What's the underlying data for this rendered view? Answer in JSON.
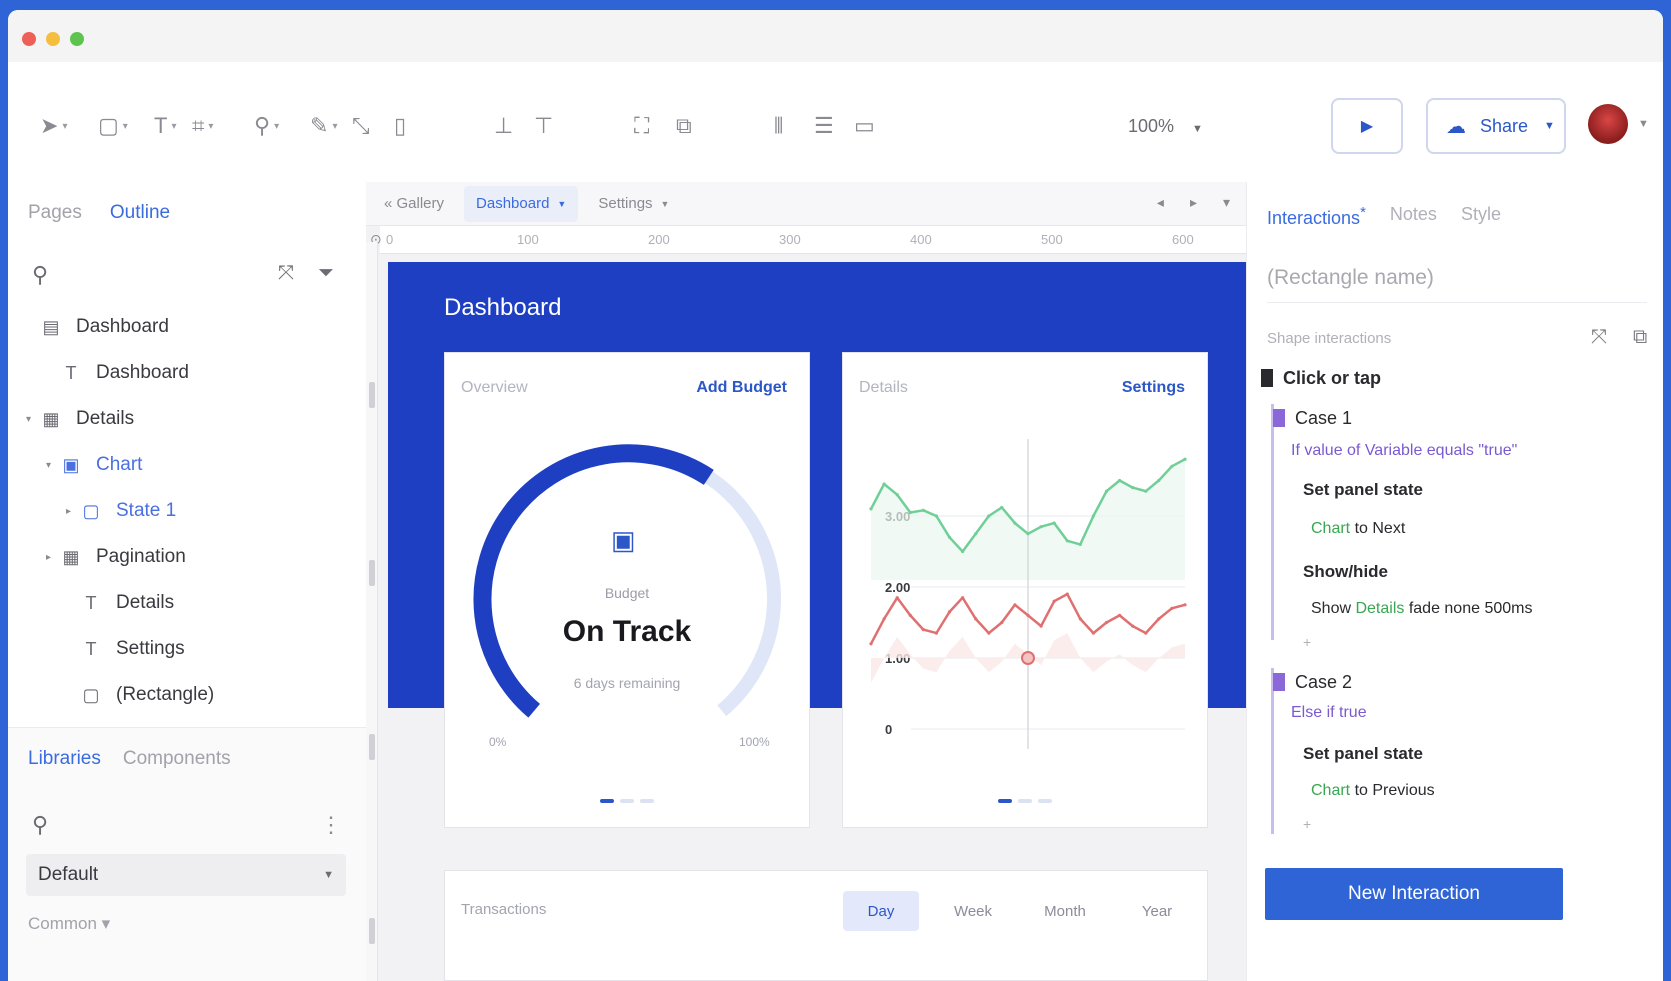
{
  "toolbar": {
    "tools": [
      {
        "icon": "pointer-icon",
        "glyph": "➤",
        "caret": "▾"
      },
      {
        "icon": "rectangle-tool-icon",
        "glyph": "▢",
        "caret": "▾"
      },
      {
        "icon": "text-tool-icon",
        "glyph": "T",
        "caret": "▾"
      },
      {
        "icon": "hotspot-tool-icon",
        "glyph": "⌗",
        "caret": "▾"
      },
      {
        "icon": "pin-tool-icon",
        "glyph": "⚲",
        "caret": "▾"
      },
      {
        "icon": "pen-tool-icon",
        "glyph": "✎",
        "caret": "▾"
      },
      {
        "icon": "connector-tool-icon",
        "glyph": "⤡",
        "caret": ""
      },
      {
        "icon": "note-tool-icon",
        "glyph": "▯",
        "caret": ""
      },
      {
        "icon": "align-top-icon",
        "glyph": "⊥",
        "caret": ""
      },
      {
        "icon": "align-middle-icon",
        "glyph": "⊤",
        "caret": ""
      },
      {
        "icon": "group-icon",
        "glyph": "⛶",
        "caret": ""
      },
      {
        "icon": "ungroup-icon",
        "glyph": "⧉",
        "caret": ""
      },
      {
        "icon": "distribute-horizontal-icon",
        "glyph": "⫴",
        "caret": ""
      },
      {
        "icon": "distribute-vertical-icon",
        "glyph": "☰",
        "caret": ""
      },
      {
        "icon": "lock-icon",
        "glyph": "▭",
        "caret": ""
      }
    ],
    "zoom": "100%",
    "share_label": "Share"
  },
  "left": {
    "tabs": [
      "Pages",
      "Outline"
    ],
    "active_tab": "Outline",
    "tree": [
      {
        "label": "Dashboard",
        "icon": "page-icon",
        "glyph": "▤",
        "arrow": "",
        "indent": 0,
        "blue": false
      },
      {
        "label": "Dashboard",
        "icon": "text-icon",
        "glyph": "T",
        "arrow": "",
        "indent": 1,
        "blue": false
      },
      {
        "label": "Details",
        "icon": "folder-icon",
        "glyph": "▦",
        "arrow": "▾",
        "indent": 0,
        "blue": false
      },
      {
        "label": "Chart",
        "icon": "dynamic-panel-icon",
        "glyph": "▣",
        "arrow": "▾",
        "indent": 1,
        "blue": true
      },
      {
        "label": "State 1",
        "icon": "state-icon",
        "glyph": "▢",
        "arrow": "▸",
        "indent": 2,
        "blue": true
      },
      {
        "label": "Pagination",
        "icon": "folder-icon",
        "glyph": "▦",
        "arrow": "▸",
        "indent": 1,
        "blue": false
      },
      {
        "label": "Details",
        "icon": "text-icon",
        "glyph": "T",
        "arrow": "",
        "indent": 2,
        "blue": false
      },
      {
        "label": "Settings",
        "icon": "text-icon",
        "glyph": "T",
        "arrow": "",
        "indent": 2,
        "blue": false
      },
      {
        "label": "(Rectangle)",
        "icon": "rectangle-icon",
        "glyph": "▢",
        "arrow": "",
        "indent": 2,
        "blue": false
      }
    ],
    "libraries": {
      "tabs": [
        "Libraries",
        "Components"
      ],
      "active_tab": "Libraries",
      "selected_library": "Default",
      "section": "Common ▾"
    }
  },
  "canvas": {
    "tabs": [
      {
        "label": "« Gallery",
        "active": false,
        "caret": false
      },
      {
        "label": "Dashboard",
        "active": true,
        "caret": true
      },
      {
        "label": "Settings",
        "active": false,
        "caret": true
      }
    ],
    "tab_actions": [
      "◂",
      "▸",
      "▾"
    ],
    "ruler_ticks": [
      "0",
      "100",
      "200",
      "300",
      "400",
      "500",
      "600"
    ],
    "dashboard_title": "Dashboard",
    "overview_card": {
      "title": "Overview",
      "action": "Add Budget",
      "label": "Budget",
      "status": "On Track",
      "subtext": "6 days remaining",
      "min": "0%",
      "max": "100%",
      "progress": 0.62
    },
    "details_card": {
      "title": "Details",
      "action": "Settings"
    },
    "chart_data": {
      "type": "line",
      "yticks": [
        "3.00",
        "2.00",
        "1.00",
        "0"
      ],
      "ylim": [
        0,
        4
      ],
      "x": [
        0,
        1,
        2,
        3,
        4,
        5,
        6,
        7,
        8,
        9,
        10,
        11,
        12,
        13,
        14,
        15,
        16,
        17,
        18,
        19,
        20,
        21,
        22,
        23,
        24
      ],
      "series": [
        {
          "values": [
            3.1,
            3.45,
            3.3,
            3.05,
            3.08,
            3.0,
            2.7,
            2.5,
            2.75,
            3.0,
            3.12,
            2.9,
            2.75,
            2.85,
            2.9,
            2.65,
            2.6,
            3.0,
            3.35,
            3.5,
            3.4,
            3.35,
            3.5,
            3.7,
            3.8
          ],
          "color": "#6fcf97"
        },
        {
          "values": [
            1.2,
            1.55,
            1.85,
            1.6,
            1.4,
            1.35,
            1.65,
            1.85,
            1.55,
            1.35,
            1.5,
            1.75,
            1.6,
            1.45,
            1.8,
            1.9,
            1.55,
            1.35,
            1.5,
            1.6,
            1.45,
            1.35,
            1.55,
            1.7,
            1.75
          ],
          "color": "#e07070"
        }
      ]
    },
    "transactions": {
      "title": "Transactions",
      "tabs": [
        "Day",
        "Week",
        "Month",
        "Year"
      ],
      "active_tab": "Day"
    }
  },
  "right": {
    "tabs": [
      "Interactions",
      "Notes",
      "Style"
    ],
    "active_tab": "Interactions",
    "tab_marker": "*",
    "widget_name_placeholder": "(Rectangle name)",
    "section_title": "Shape interactions",
    "event": "Click or tap",
    "case1": {
      "name": "Case 1",
      "condition": "If value of Variable equals \"true\"",
      "action1": "Set panel state",
      "action1_target": "Chart",
      "action1_detail": " to Next",
      "action2": "Show/hide",
      "action2_prefix": "Show ",
      "action2_target": "Details",
      "action2_detail": " fade none 500ms"
    },
    "case2": {
      "name": "Case 2",
      "condition": "Else if true",
      "action1": "Set panel state",
      "action1_target": "Chart",
      "action1_detail": " to Previous"
    },
    "new_interaction_label": "New Interaction",
    "accent_color": "#2f64d6"
  }
}
